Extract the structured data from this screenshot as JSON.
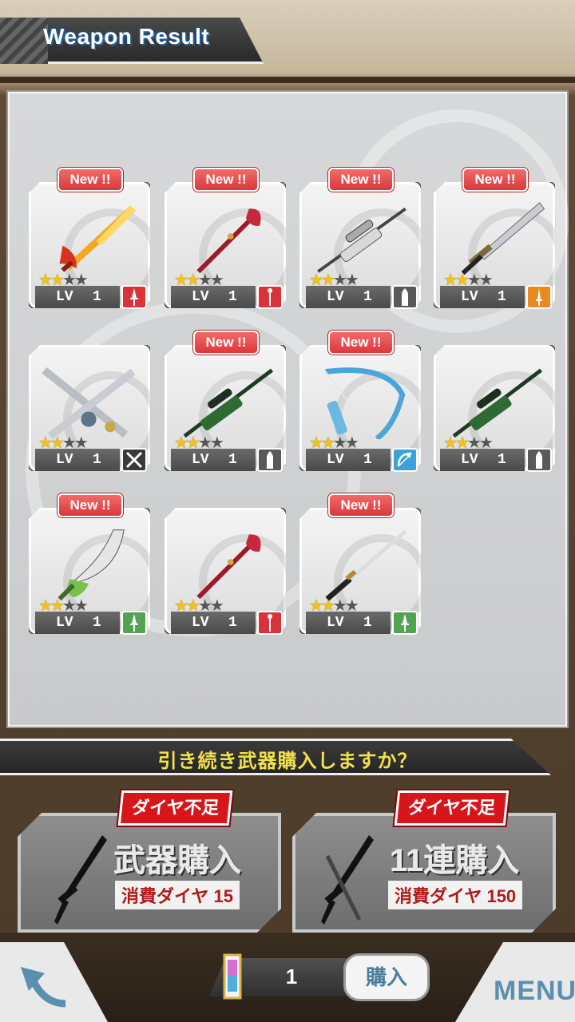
{
  "header": {
    "title": "Weapon Result"
  },
  "cards": [
    {
      "new_badge": "New !!",
      "lv_prefix": "LV",
      "level": "1",
      "stars": 2,
      "max_stars": 4,
      "type_icon": "dagger-icon",
      "type_color": "#d8333a",
      "weapon": "flame-sword"
    },
    {
      "new_badge": "New !!",
      "lv_prefix": "LV",
      "level": "1",
      "stars": 2,
      "max_stars": 4,
      "type_icon": "staff-icon",
      "type_color": "#d8333a",
      "weapon": "red-staff"
    },
    {
      "new_badge": "New !!",
      "lv_prefix": "LV",
      "level": "1",
      "stars": 2,
      "max_stars": 4,
      "type_icon": "bullet-icon",
      "type_color": "#595959",
      "weapon": "sniper-rifle-white"
    },
    {
      "new_badge": "New !!",
      "lv_prefix": "LV",
      "level": "1",
      "stars": 2,
      "max_stars": 4,
      "type_icon": "sword-icon",
      "type_color": "#e88a1d",
      "weapon": "long-sword"
    },
    {
      "new_badge": "",
      "lv_prefix": "LV",
      "level": "1",
      "stars": 2,
      "max_stars": 4,
      "type_icon": "crossed-swords-icon",
      "type_color": "#3a3a3a",
      "weapon": "dual-swords"
    },
    {
      "new_badge": "New !!",
      "lv_prefix": "LV",
      "level": "1",
      "stars": 2,
      "max_stars": 4,
      "type_icon": "bullet-icon",
      "type_color": "#595959",
      "weapon": "sniper-rifle-green"
    },
    {
      "new_badge": "New !!",
      "lv_prefix": "LV",
      "level": "1",
      "stars": 2,
      "max_stars": 4,
      "type_icon": "bow-icon",
      "type_color": "#3ba3d8",
      "weapon": "blue-bow"
    },
    {
      "new_badge": "",
      "lv_prefix": "LV",
      "level": "1",
      "stars": 2,
      "max_stars": 4,
      "type_icon": "bullet-icon",
      "type_color": "#595959",
      "weapon": "sniper-rifle-green"
    },
    {
      "new_badge": "New !!",
      "lv_prefix": "LV",
      "level": "1",
      "stars": 2,
      "max_stars": 4,
      "type_icon": "dagger-icon",
      "type_color": "#53a452",
      "weapon": "green-scimitar"
    },
    {
      "new_badge": "",
      "lv_prefix": "LV",
      "level": "1",
      "stars": 2,
      "max_stars": 4,
      "type_icon": "staff-icon",
      "type_color": "#d8333a",
      "weapon": "red-staff"
    },
    {
      "new_badge": "New !!",
      "lv_prefix": "LV",
      "level": "1",
      "stars": 2,
      "max_stars": 4,
      "type_icon": "dagger-icon",
      "type_color": "#53a452",
      "weapon": "katana"
    }
  ],
  "prompt": {
    "text": "引き続き武器購入しますか？"
  },
  "buy_single": {
    "warning": "ダイヤ不足",
    "title": "武器購入",
    "cost": "消費ダイヤ 15"
  },
  "buy_multi": {
    "warning": "ダイヤ不足",
    "title": "11連購入",
    "cost": "消費ダイヤ 150"
  },
  "footer": {
    "count": "1",
    "purchase_label": "購入",
    "menu_label": "MENU"
  },
  "colors": {
    "accent_blue": "#5b8fb0",
    "warning_red": "#d7161c",
    "prompt_yellow": "#f2e14a"
  }
}
